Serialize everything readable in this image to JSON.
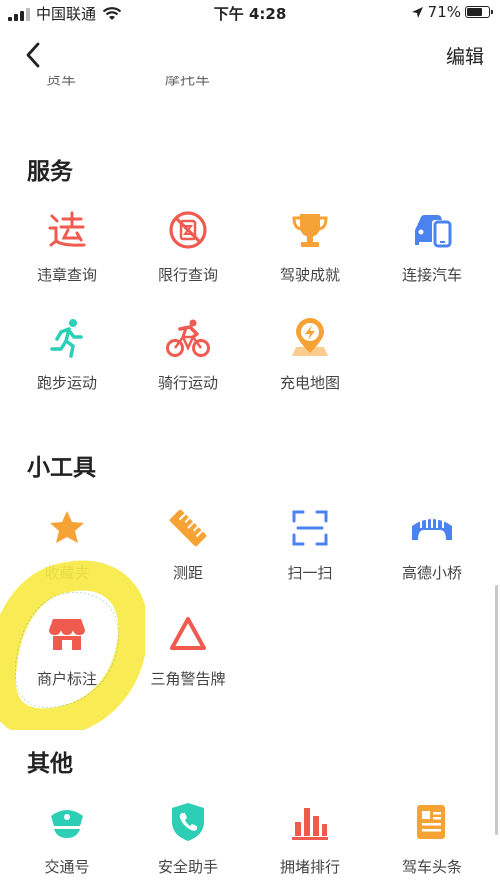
{
  "status": {
    "carrier": "中国联通",
    "time": "下午 4:28",
    "battery": "71%",
    "battery_level": 0.71
  },
  "nav": {
    "edit_label": "编辑"
  },
  "partial_top_labels": [
    "货车",
    "摩托车"
  ],
  "sections": [
    {
      "title": "服务",
      "items": [
        {
          "label": "违章查询",
          "icon": "violation-char-icon",
          "color": "#f05a4f"
        },
        {
          "label": "限行查询",
          "icon": "restriction-icon",
          "color": "#f05a4f"
        },
        {
          "label": "驾驶成就",
          "icon": "trophy-icon",
          "color": "#f7a234"
        },
        {
          "label": "连接汽车",
          "icon": "car-phone-icon",
          "color": "#4a82f0"
        },
        {
          "label": "跑步运动",
          "icon": "running-icon",
          "color": "#2ccfb6"
        },
        {
          "label": "骑行运动",
          "icon": "cycling-icon",
          "color": "#f05a4f"
        },
        {
          "label": "充电地图",
          "icon": "charging-map-icon",
          "color": "#f7a234"
        }
      ]
    },
    {
      "title": "小工具",
      "items": [
        {
          "label": "收藏夹",
          "icon": "star-icon",
          "color": "#f7a234"
        },
        {
          "label": "测距",
          "icon": "ruler-icon",
          "color": "#f7a234"
        },
        {
          "label": "扫一扫",
          "icon": "scan-icon",
          "color": "#4a82f0"
        },
        {
          "label": "高德小桥",
          "icon": "bridge-icon",
          "color": "#4a82f0"
        },
        {
          "label": "商户标注",
          "icon": "shop-icon",
          "color": "#f05a4f"
        },
        {
          "label": "三角警告牌",
          "icon": "warning-triangle-icon",
          "color": "#f05a4f"
        }
      ]
    },
    {
      "title": "其他",
      "items": [
        {
          "label": "交通号",
          "icon": "police-cap-icon",
          "color": "#2ccfb6"
        },
        {
          "label": "安全助手",
          "icon": "phone-shield-icon",
          "color": "#2ccfb6"
        },
        {
          "label": "拥堵排行",
          "icon": "bar-chart-icon",
          "color": "#f05a4f"
        },
        {
          "label": "驾车头条",
          "icon": "news-icon",
          "color": "#f7a234"
        }
      ]
    }
  ],
  "highlight_color": "#f7e835"
}
